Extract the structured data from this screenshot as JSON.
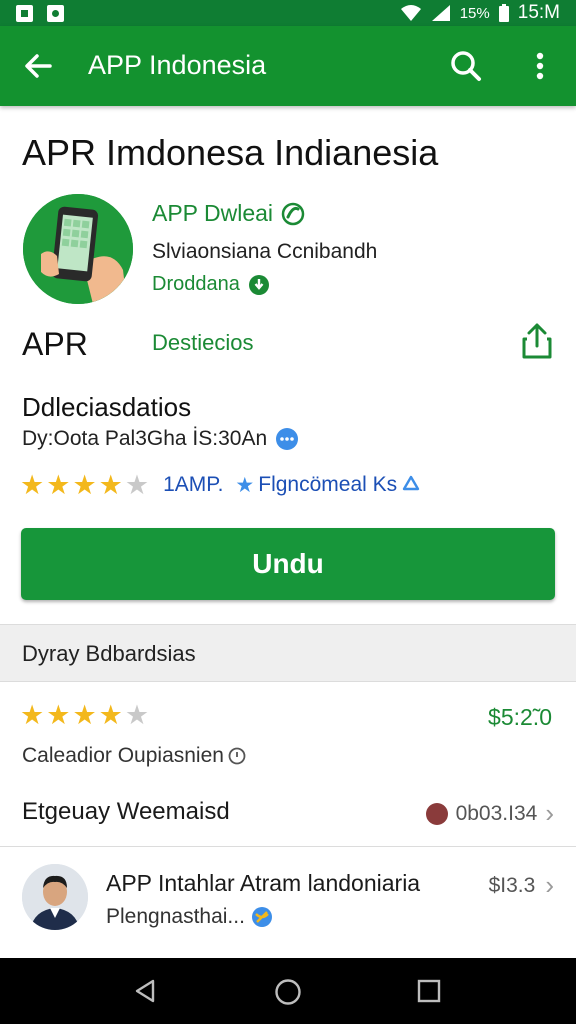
{
  "status_bar": {
    "battery_percent": "15%",
    "time": "15:M",
    "icons": [
      "notification-icon",
      "notification-icon",
      "wifi-icon",
      "signal-icon",
      "battery-icon"
    ]
  },
  "app_bar": {
    "title": "APP Indonesia",
    "icons": [
      "back-arrow-icon",
      "search-icon",
      "more-vert-icon"
    ]
  },
  "app": {
    "title": "APR Imdonesa Indianesia",
    "developer": "APP Dwleai",
    "subtitle": "Slviaonsiana Ccnibandh",
    "category": "Droddana",
    "short_name": "APR",
    "details_link": "Destiecios",
    "section_title": "Ddleciasdatios",
    "meta_line": "Dy:Oota Pal3Gha İS:30An",
    "rating": 4,
    "rating_max": 5,
    "rating_label": "1AMP.",
    "featured_label": "Flgncömeal Ks",
    "install_label": "Undu"
  },
  "reviews": {
    "band_label": "Dyray Bdbardsias",
    "stars": 4,
    "stars_max": 5,
    "price": "$5:2̃.0",
    "text": "Caleadior Oupiasnien",
    "row_title": "Etgeuay Weemaisd",
    "row_meta": "0b03.I34"
  },
  "listing": {
    "title": "APP Intahlar Atram landoniaria",
    "subtitle": "Plengnasthai...",
    "price": "$I3.3"
  },
  "colors": {
    "status_bar": "#0f7d33",
    "app_bar": "#13922f",
    "accent_green": "#1b8a35",
    "button_green": "#17963a",
    "star": "#f3b81c",
    "link_blue": "#1c4fb5"
  }
}
